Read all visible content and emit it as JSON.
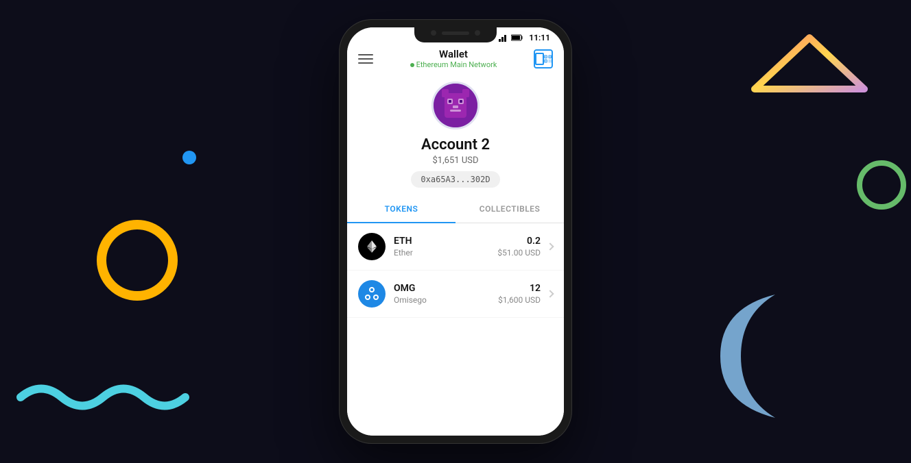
{
  "background": "#0d0d1a",
  "decorations": {
    "yellow_circle": {
      "color": "#FFB300"
    },
    "blue_dot": {
      "color": "#2196F3"
    },
    "green_squiggle": {
      "color": "#4DD0E1"
    },
    "triangle": {
      "colors": [
        "#FF8A65",
        "#FFD54F",
        "#F48FB1",
        "#CE93D8"
      ]
    },
    "green_circle": {
      "color": "#66BB6A"
    },
    "crescent": {
      "color": "#90CAF9"
    }
  },
  "status_bar": {
    "time": "11:11",
    "wifi_icon": "wifi-icon",
    "signal_icon": "signal-icon",
    "battery_icon": "battery-icon"
  },
  "header": {
    "title": "Wallet",
    "network_label": "Ethereum Main Network",
    "hamburger_label": "menu",
    "qr_label": "scan qr"
  },
  "account": {
    "name": "Account 2",
    "balance_usd": "$1,651 USD",
    "address": "0xa65A3...302D"
  },
  "tabs": [
    {
      "label": "TOKENS",
      "active": true
    },
    {
      "label": "COLLECTIBLES",
      "active": false
    }
  ],
  "tokens": [
    {
      "symbol": "ETH",
      "name": "Ether",
      "balance": "0.2",
      "usd": "$51.00 USD",
      "icon_type": "eth"
    },
    {
      "symbol": "OMG",
      "name": "Omisego",
      "balance": "12",
      "usd": "$1,600 USD",
      "icon_type": "omg"
    }
  ]
}
